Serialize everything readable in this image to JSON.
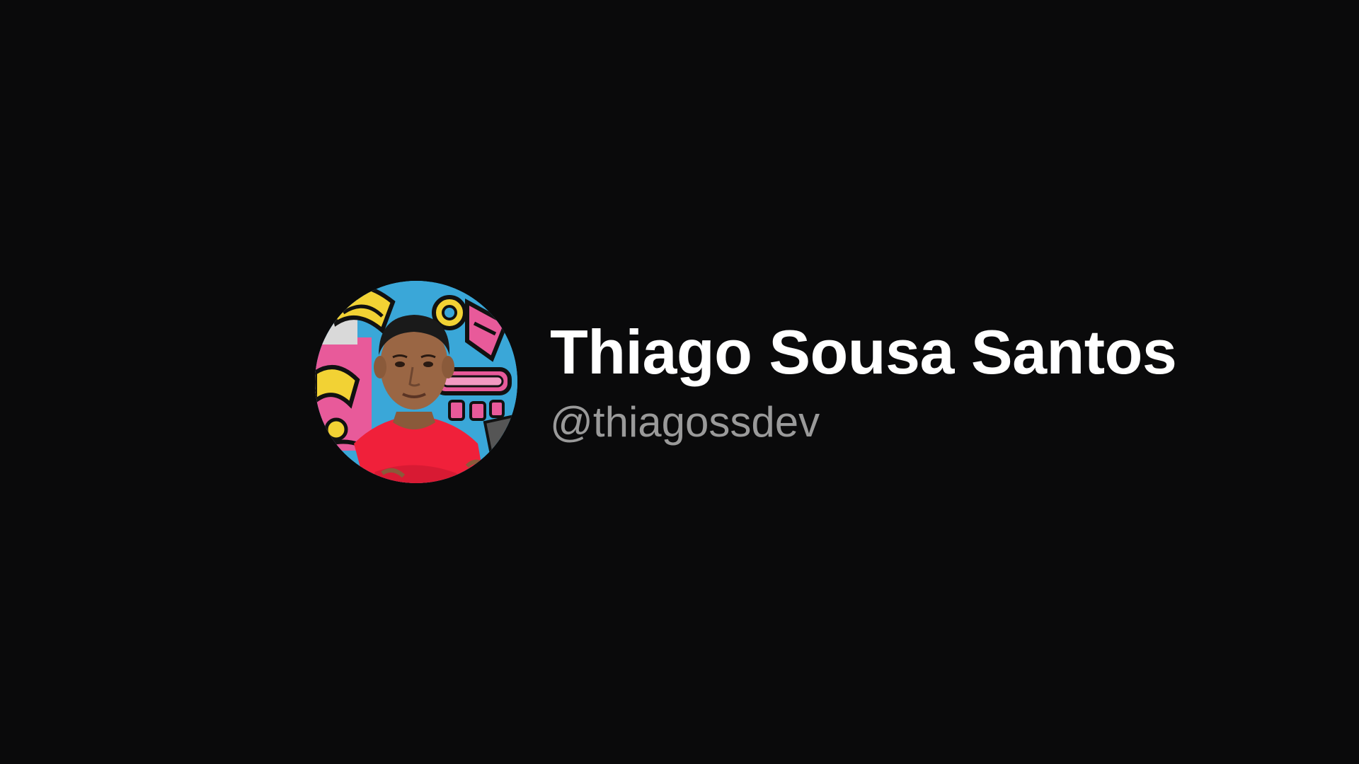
{
  "profile": {
    "name": "Thiago Sousa Santos",
    "handle": "@thiagossdev",
    "avatar_alt": "Thiago Sousa Santos"
  },
  "colors": {
    "background": "#0a0a0b",
    "name_text": "#ffffff",
    "handle_text": "#9a9a9a",
    "shirt": "#f0203a",
    "mural_blue": "#3aa7d8",
    "mural_pink": "#e85a9a",
    "mural_yellow": "#f2d234"
  },
  "icons": {
    "avatar": "profile-photo"
  }
}
